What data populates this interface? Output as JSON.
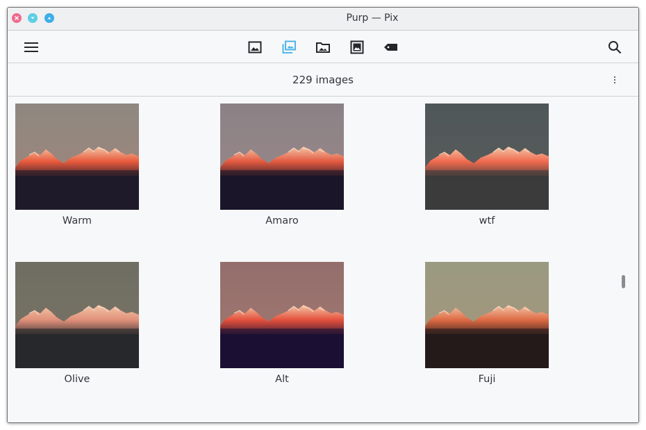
{
  "window": {
    "title": "Purp — Pix"
  },
  "toolbar": {
    "menu_icon": "hamburger-menu-icon",
    "views": [
      {
        "name": "gallery-view",
        "icon": "image-icon",
        "active": false
      },
      {
        "name": "collections-view",
        "icon": "images-stack-icon",
        "active": true
      },
      {
        "name": "folders-view",
        "icon": "folder-image-icon",
        "active": false
      },
      {
        "name": "viewer-view",
        "icon": "framed-image-icon",
        "active": false
      },
      {
        "name": "tags-view",
        "icon": "tag-icon",
        "active": false
      }
    ],
    "search_icon": "search-icon",
    "active_color": "#3daee9"
  },
  "status": {
    "count_text": "229 images"
  },
  "images": [
    {
      "label": "Warm",
      "sky_top": "#8e8880",
      "sky_bottom": "#a3857a",
      "glow": "#e85a3c",
      "ground": "#1f1a2a"
    },
    {
      "label": "Amaro",
      "sky_top": "#8b8286",
      "sky_bottom": "#9b8888",
      "glow": "#e35a40",
      "ground": "#1a1528"
    },
    {
      "label": "wtf",
      "sky_top": "#4f5758",
      "sky_bottom": "#5b5c5d",
      "glow": "#f06a4e",
      "ground": "#3b3b3b"
    },
    {
      "label": "Olive",
      "sky_top": "#6f6e62",
      "sky_bottom": "#7a7266",
      "glow": "#e0907a",
      "ground": "#26282c"
    },
    {
      "label": "Alt",
      "sky_top": "#936e6c",
      "sky_bottom": "#a37a70",
      "glow": "#e4503c",
      "ground": "#1b1033"
    },
    {
      "label": "Fuji",
      "sky_top": "#9a9a82",
      "sky_bottom": "#a59478",
      "glow": "#dd6a44",
      "ground": "#251a1a"
    }
  ]
}
